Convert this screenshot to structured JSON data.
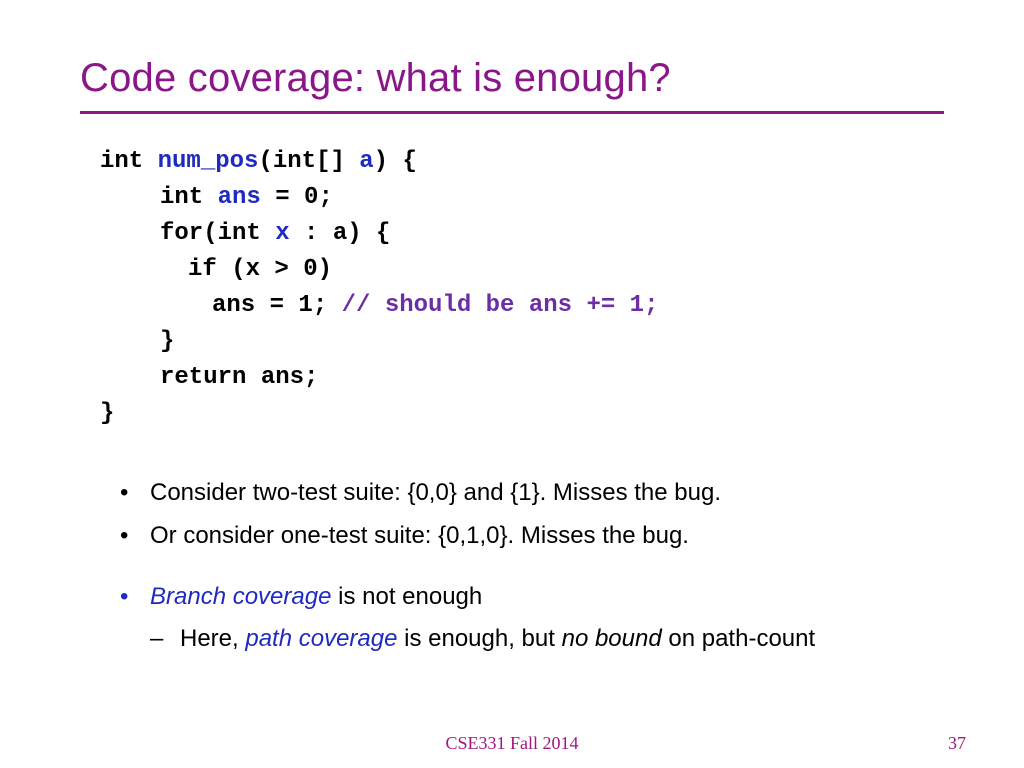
{
  "title": "Code coverage: what is enough?",
  "code": {
    "l1_a": "int ",
    "l1_b": "num_pos",
    "l1_c": "(int[] ",
    "l1_d": "a",
    "l1_e": ") {",
    "l2_a": "int ",
    "l2_b": "ans",
    "l2_c": " = 0;",
    "l3_a": "for(int ",
    "l3_b": "x",
    "l3_c": " : a) {",
    "l4": "if (x > 0)",
    "l5_a": "ans = 1; ",
    "l5_b": "// should be ans += 1;",
    "l6": "}",
    "l7": "return ans;",
    "l8": "}"
  },
  "bullets": {
    "b1": "Consider two-test suite: {0,0} and {1}.  Misses the bug.",
    "b2": "Or consider one-test suite: {0,1,0}.  Misses the bug.",
    "b3_term": "Branch coverage",
    "b3_rest": " is not enough",
    "b3_sub_a": "Here, ",
    "b3_sub_b": "path coverage",
    "b3_sub_c": " is enough, but ",
    "b3_sub_d": "no bound",
    "b3_sub_e": " on path-count"
  },
  "footer": "CSE331 Fall 2014",
  "page": "37"
}
